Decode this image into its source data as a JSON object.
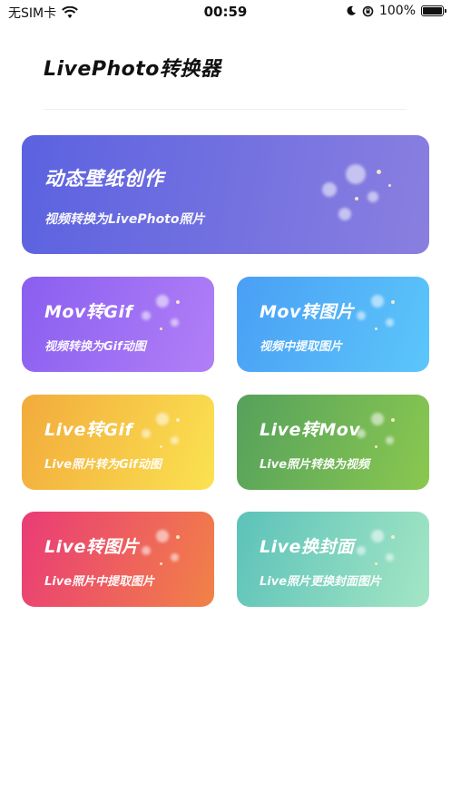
{
  "status": {
    "carrier": "无SIM卡",
    "time": "00:59",
    "battery": "100%",
    "battery_level": 1.0
  },
  "header": {
    "title": "LivePhoto转换器"
  },
  "hero": {
    "title": "动态壁纸创作",
    "subtitle": "视频转换为LivePhoto照片",
    "gradient": [
      "#5b62e0",
      "#8a7fe0"
    ]
  },
  "tiles": [
    {
      "title": "Mov转Gif",
      "subtitle": "视频转换为Gif动图",
      "gradient": [
        "#8a5ff0",
        "#b17ff7"
      ]
    },
    {
      "title": "Mov转图片",
      "subtitle": "视频中提取图片",
      "gradient": [
        "#4a9ff5",
        "#5cc6fa"
      ]
    },
    {
      "title": "Live转Gif",
      "subtitle": "Live照片转为Gif动图",
      "gradient": [
        "#f2ab3c",
        "#fbe251"
      ]
    },
    {
      "title": "Live转Mov",
      "subtitle": "Live照片转换为视频",
      "gradient": [
        "#55a15c",
        "#8bc850"
      ]
    },
    {
      "title": "Live转图片",
      "subtitle": "Live照片中提取图片",
      "gradient": [
        "#ea3b77",
        "#f18247"
      ]
    },
    {
      "title": "Live换封面",
      "subtitle": "Live照片更换封面图片",
      "gradient": [
        "#5cc2b9",
        "#a4e6c5"
      ]
    }
  ]
}
